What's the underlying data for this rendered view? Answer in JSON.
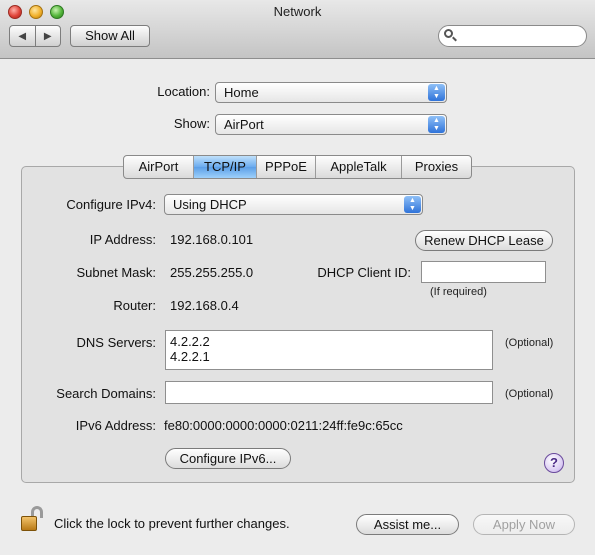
{
  "window": {
    "title": "Network",
    "controls": {
      "close": "close-icon",
      "minimize": "minimize-icon",
      "zoom": "zoom-icon"
    }
  },
  "toolbar": {
    "back_glyph": "◀",
    "forward_glyph": "▶",
    "show_all_label": "Show All",
    "search_placeholder": ""
  },
  "location": {
    "label": "Location:",
    "value": "Home"
  },
  "show": {
    "label": "Show:",
    "value": "AirPort"
  },
  "tabs": [
    {
      "label": "AirPort",
      "selected": false
    },
    {
      "label": "TCP/IP",
      "selected": true
    },
    {
      "label": "PPPoE",
      "selected": false
    },
    {
      "label": "AppleTalk",
      "selected": false
    },
    {
      "label": "Proxies",
      "selected": false
    }
  ],
  "tcpip": {
    "configure_label": "Configure IPv4:",
    "configure_value": "Using DHCP",
    "ip_label": "IP Address:",
    "ip_value": "192.168.0.101",
    "renew_button": "Renew DHCP Lease",
    "subnet_label": "Subnet Mask:",
    "subnet_value": "255.255.255.0",
    "client_id_label": "DHCP Client ID:",
    "client_id_value": "",
    "client_id_hint": "(If required)",
    "router_label": "Router:",
    "router_value": "192.168.0.4",
    "dns_label": "DNS Servers:",
    "dns_servers": [
      "4.2.2.2",
      "4.2.2.1"
    ],
    "dns_hint": "(Optional)",
    "search_domains_label": "Search Domains:",
    "search_domains_value": "",
    "search_domains_hint": "(Optional)",
    "ipv6_label": "IPv6 Address:",
    "ipv6_value": "fe80:0000:0000:0000:0211:24ff:fe9c:65cc",
    "configure_ipv6_button": "Configure IPv6...",
    "help_glyph": "?"
  },
  "footer": {
    "lock_text": "Click the lock to prevent further changes.",
    "assist_button": "Assist me...",
    "apply_button": "Apply Now"
  }
}
